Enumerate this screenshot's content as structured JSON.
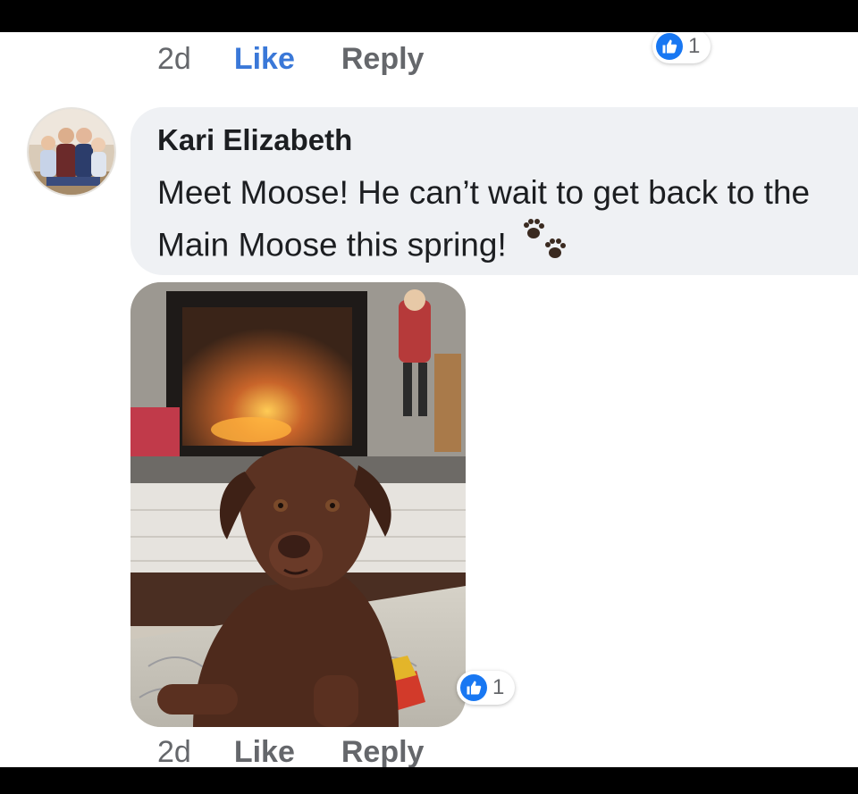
{
  "top_comment": {
    "time": "2d",
    "like_label": "Like",
    "reply_label": "Reply",
    "reaction_count": "1"
  },
  "comment": {
    "author": "Kari Elizabeth",
    "text": "Meet Moose! He can’t wait to get back to the Main Moose this spring!",
    "emoji": "paw-prints",
    "time": "2d",
    "like_label": "Like",
    "reply_label": "Reply",
    "reaction_count": "1"
  },
  "colors": {
    "like_active": "#3a78d8",
    "reaction_blue": "#1877f2",
    "bubble_bg": "#eff1f4"
  }
}
